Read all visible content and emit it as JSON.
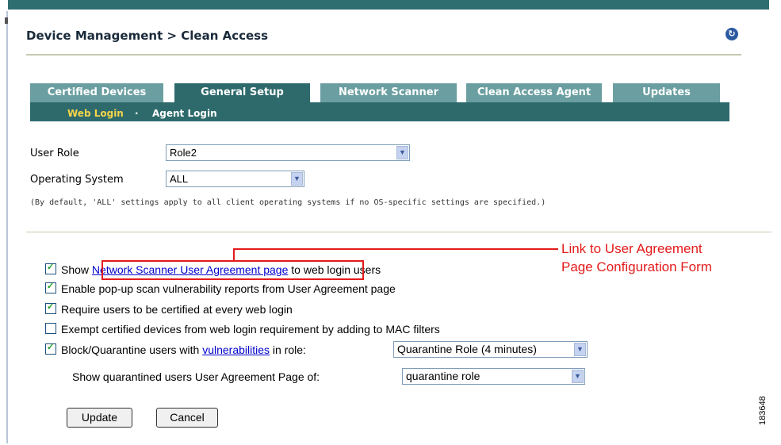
{
  "header": {
    "title": "Device Management > Clean Access",
    "help_icon": "refresh-icon"
  },
  "tabs": [
    {
      "label": "Certified Devices",
      "active": false
    },
    {
      "label": "General Setup",
      "active": true
    },
    {
      "label": "Network Scanner",
      "active": false
    },
    {
      "label": "Clean Access Agent",
      "active": false
    },
    {
      "label": "Updates",
      "active": false
    }
  ],
  "subtabs": {
    "web_login": "Web Login",
    "separator": "·",
    "agent_login": "Agent Login"
  },
  "form": {
    "user_role_label": "User Role",
    "user_role_value": "Role2",
    "os_label": "Operating System",
    "os_value": "ALL",
    "note": "(By default, 'ALL' settings apply to all client operating systems if no OS-specific settings are specified.)"
  },
  "options": {
    "show_prefix": "Show",
    "show_link": "Network Scanner User Agreement page",
    "show_suffix": "to web login users",
    "popup": "Enable pop-up scan vulnerability reports from User Agreement page",
    "require": "Require users to be certified at every web login",
    "exempt": "Exempt certified devices from web login requirement by adding to MAC filters",
    "block_prefix": "Block/Quarantine users with",
    "block_link": "vulnerabilities",
    "block_suffix": "in role:",
    "block_role_value": "Quarantine Role  (4 minutes)",
    "quarantine_label": "Show quarantined users User Agreement Page of:",
    "quarantine_value": "quarantine role",
    "checked": {
      "show": true,
      "popup": true,
      "require": true,
      "exempt": false,
      "block": true
    }
  },
  "buttons": {
    "update": "Update",
    "cancel": "Cancel"
  },
  "callout": {
    "line1": "Link to User Agreement",
    "line2": "Page Configuration Form"
  },
  "figure_number": "183648",
  "colors": {
    "tab_active": "#2e6a6c",
    "tab_inactive": "#6a9ea0",
    "subtab_active_text": "#f5d54a",
    "callout": "#e41a1a"
  }
}
